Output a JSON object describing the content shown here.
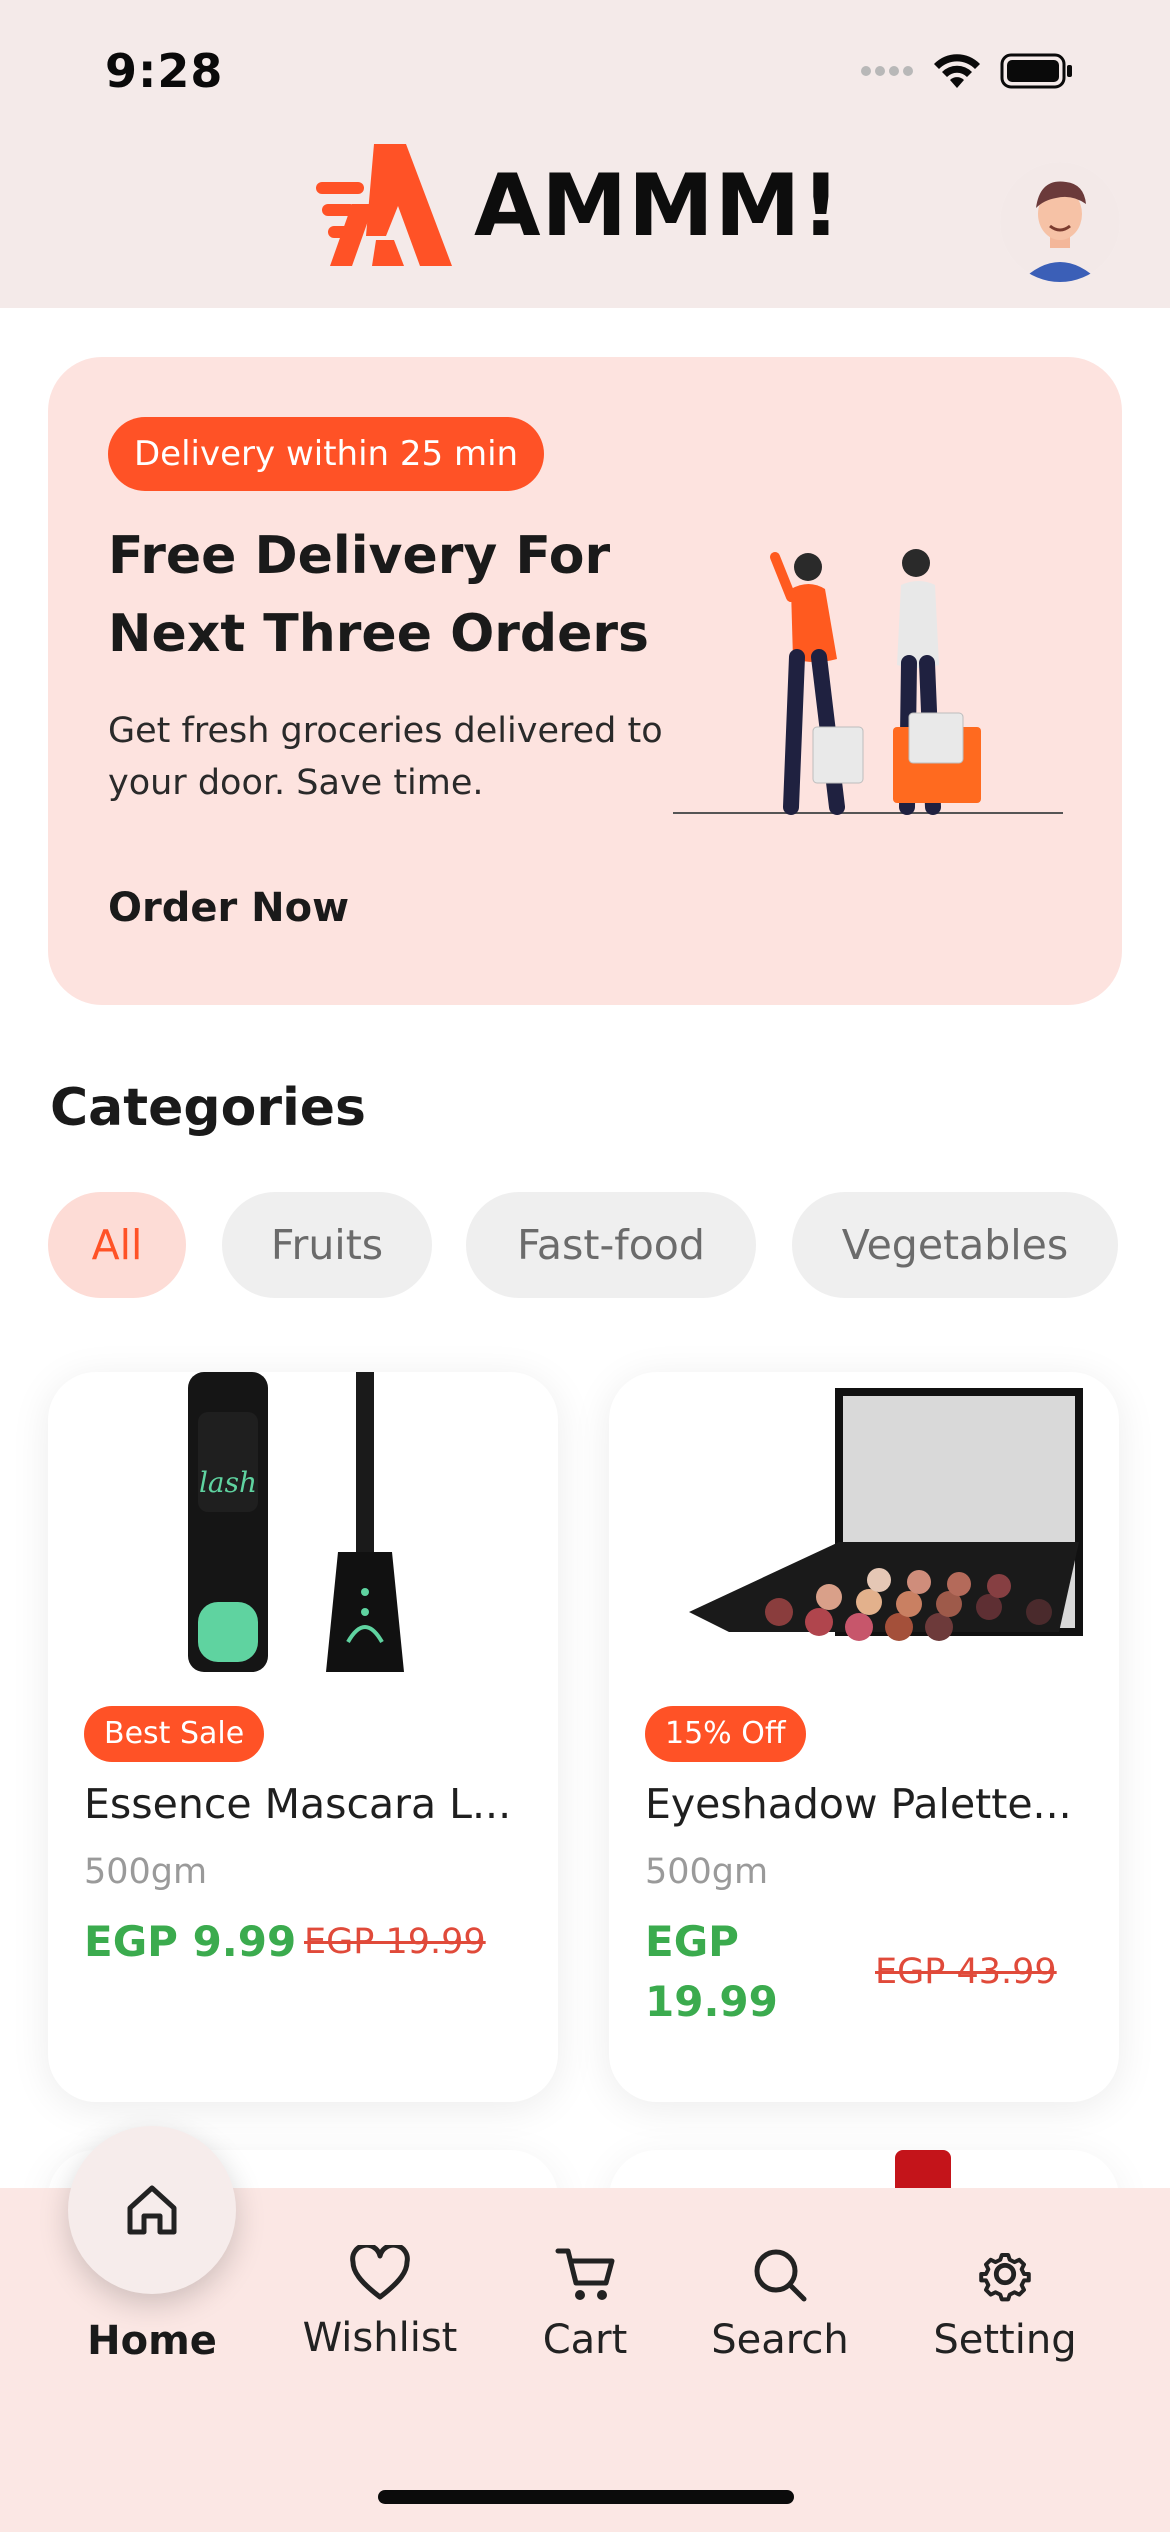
{
  "status_bar": {
    "time": "9:28"
  },
  "header": {
    "brand": "AMMM!"
  },
  "promo": {
    "badge": "Delivery within 25 min",
    "title": "Free Delivery For Next Three Orders",
    "subtitle": "Get fresh groceries delivered to your door. Save time.",
    "cta": "Order Now"
  },
  "categories": {
    "title": "Categories",
    "chips": [
      "All",
      "Fruits",
      "Fast-food",
      "Vegetables"
    ],
    "active": "All"
  },
  "products": [
    {
      "badge": "Best Sale",
      "name": "Essence Mascara L...",
      "weight": "500gm",
      "price": "EGP 9.99",
      "old_price": "EGP 19.99"
    },
    {
      "badge": "15% Off",
      "name": "Eyeshadow Palette...",
      "weight": "500gm",
      "price": "EGP 19.99",
      "old_price": "EGP 43.99"
    }
  ],
  "nav": {
    "items": [
      {
        "label": "Home",
        "icon": "home-icon"
      },
      {
        "label": "Wishlist",
        "icon": "heart-icon"
      },
      {
        "label": "Cart",
        "icon": "cart-icon"
      },
      {
        "label": "Search",
        "icon": "search-icon"
      },
      {
        "label": "Setting",
        "icon": "gear-icon"
      }
    ],
    "active": "Home"
  },
  "colors": {
    "accent": "#ff5226",
    "price_green": "#3bab4e",
    "promo_bg": "#fde3df",
    "nav_bg": "#fbe7e4"
  }
}
